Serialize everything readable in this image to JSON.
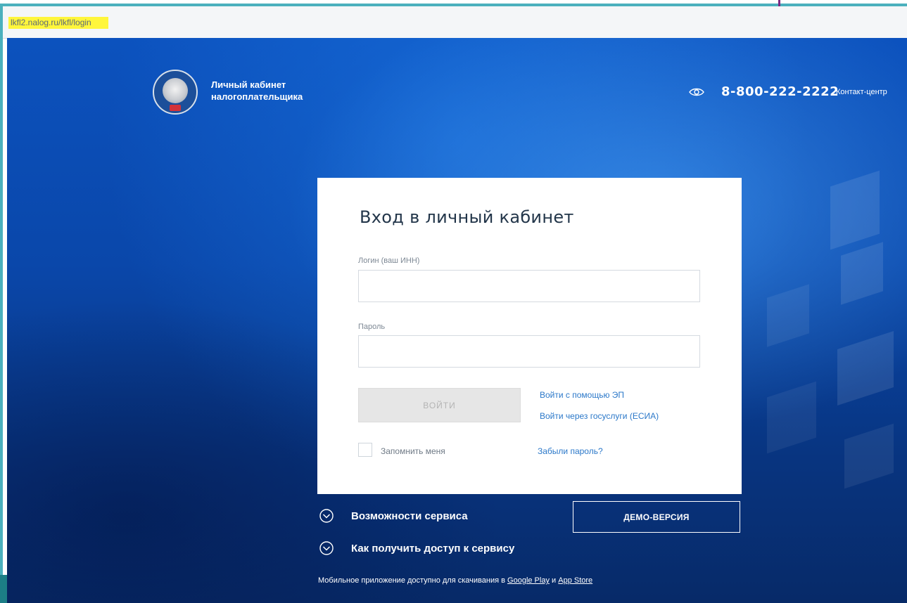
{
  "browser": {
    "url": "lkfl2.nalog.ru/lkfl/login"
  },
  "header": {
    "brand_line1": "Личный кабинет",
    "brand_line2": "налогоплательщика",
    "phone": "8-800-222-2222",
    "contact_label": "Контакт-центр"
  },
  "login_card": {
    "title": "Вход в личный кабинет",
    "login_label": "Логин (ваш ИНН)",
    "login_value": "",
    "password_label": "Пароль",
    "password_value": "",
    "submit_label": "ВОЙТИ",
    "link_ep": "Войти с помощью ЭП",
    "link_gosuslugi": "Войти через госуслуги (ЕСИА)",
    "remember_label": "Запомнить меня",
    "remember_checked": false,
    "forgot_label": "Забыли пароль?"
  },
  "below": {
    "features_label": "Возможности сервиса",
    "access_label": "Как получить доступ к сервису",
    "demo_label": "ДЕМО-ВЕРСИЯ",
    "mobile_text": "Мобильное приложение доступно для скачивания в",
    "google_play": "Google Play",
    "and_text": "и",
    "app_store": "App Store"
  },
  "colors": {
    "accent_frame": "#4bb0bd",
    "background_blue": "#0a47aa",
    "link": "#2b78c9",
    "url_highlight": "#fff63b"
  }
}
